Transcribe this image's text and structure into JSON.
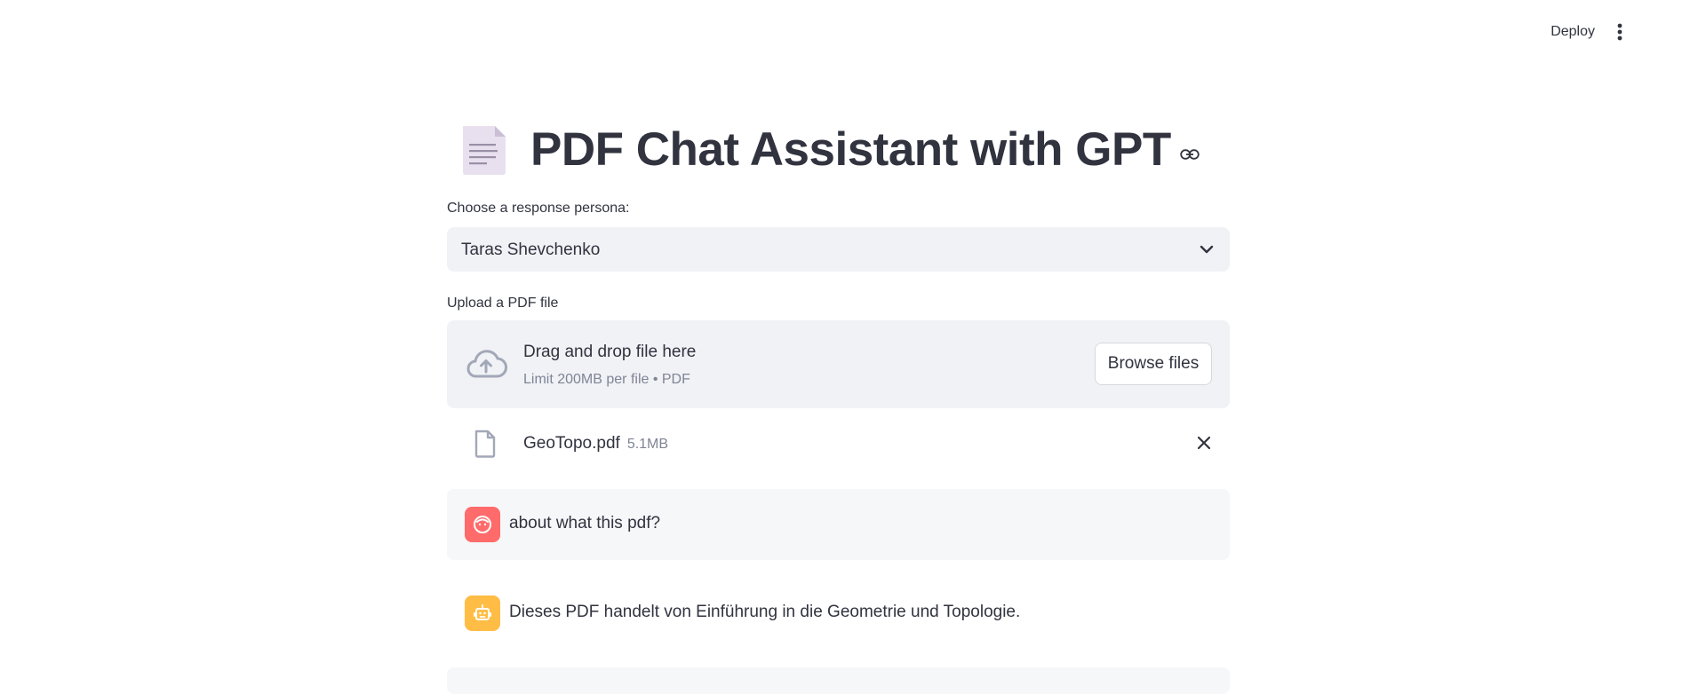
{
  "header": {
    "deploy_label": "Deploy",
    "menu_icon": "vertical-ellipsis-icon"
  },
  "page": {
    "title": "PDF Chat Assistant with GPT",
    "title_icon": "page-facing-up-emoji",
    "anchor_icon": "link-icon"
  },
  "persona": {
    "label": "Choose a response persona:",
    "selected": "Taras Shevchenko"
  },
  "uploader": {
    "label": "Upload a PDF file",
    "drop_title": "Drag and drop file here",
    "drop_limit": "Limit 200MB per file • PDF",
    "browse_label": "Browse files",
    "file": {
      "name": "GeoTopo.pdf",
      "size": "5.1MB"
    }
  },
  "chat": [
    {
      "role": "user",
      "avatar_icon": "smiley-face-icon",
      "text": "about what this pdf?"
    },
    {
      "role": "assistant",
      "avatar_icon": "robot-icon",
      "text": "Dieses PDF handelt von Einführung in die Geometrie und Topologie."
    }
  ],
  "colors": {
    "accent": "#ff4b4b",
    "user_avatar": "#ff6b6b",
    "bot_avatar": "#ffbd45",
    "input_bg": "#f0f2f6",
    "text": "#31333f",
    "muted": "#808495"
  }
}
